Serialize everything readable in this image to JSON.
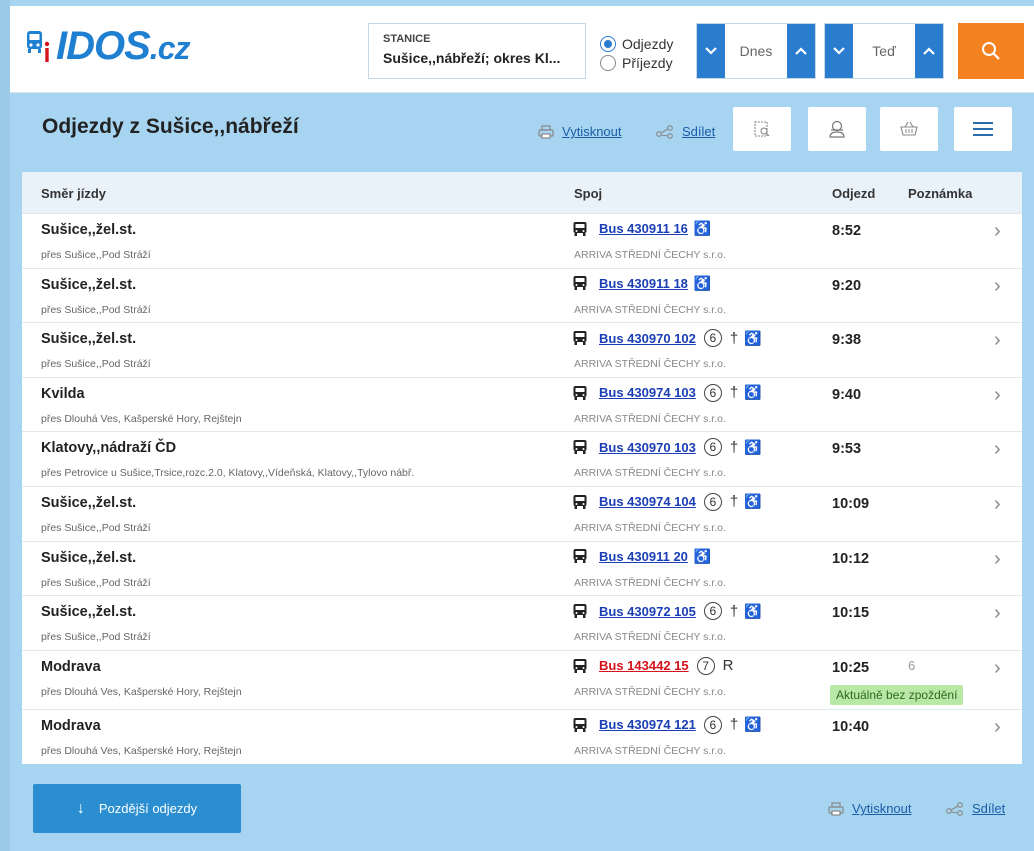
{
  "app": {
    "logo_main": "IDOS",
    "logo_suffix": ".cz",
    "brand_color": "#1f7fd1",
    "accent_color": "#f58220"
  },
  "search": {
    "station_label": "STANICE",
    "station_value": "Sušice,,nábřeží; okres Kl...",
    "mode_options": [
      "Odjezdy",
      "Příjezdy"
    ],
    "mode_selected": "Odjezdy",
    "date_value": "Dnes",
    "time_value": "Teď",
    "search_icon": "search-icon"
  },
  "header": {
    "title": "Odjezdy z Sušice,,nábřeží",
    "print_label": "Vytisknout",
    "share_label": "Sdílet"
  },
  "table": {
    "columns": [
      "Směr jízdy",
      "Spoj",
      "Odjezd",
      "Poznámka"
    ],
    "rows": [
      {
        "dest": "Sušice,,žel.st.",
        "via": "přes Sušice,,Pod Stráží",
        "bus": "Bus 430911 16",
        "marks": {
          "day": "",
          "cross": false,
          "R": false,
          "wheel": true
        },
        "carrier": "ARRIVA STŘEDNÍ ČECHY s.r.o.",
        "time": "8:52",
        "note": "",
        "status": "",
        "red": false
      },
      {
        "dest": "Sušice,,žel.st.",
        "via": "přes Sušice,,Pod Stráží",
        "bus": "Bus 430911 18",
        "marks": {
          "day": "",
          "cross": false,
          "R": false,
          "wheel": true
        },
        "carrier": "ARRIVA STŘEDNÍ ČECHY s.r.o.",
        "time": "9:20",
        "note": "",
        "status": "",
        "red": false
      },
      {
        "dest": "Sušice,,žel.st.",
        "via": "přes Sušice,,Pod Stráží",
        "bus": "Bus 430970 102",
        "marks": {
          "day": "6",
          "cross": true,
          "R": false,
          "wheel": true
        },
        "carrier": "ARRIVA STŘEDNÍ ČECHY s.r.o.",
        "time": "9:38",
        "note": "",
        "status": "",
        "red": false
      },
      {
        "dest": "Kvilda",
        "via": "přes Dlouhá Ves, Kašperské Hory, Rejštejn",
        "bus": "Bus 430974 103",
        "marks": {
          "day": "6",
          "cross": true,
          "R": false,
          "wheel": true
        },
        "carrier": "ARRIVA STŘEDNÍ ČECHY s.r.o.",
        "time": "9:40",
        "note": "",
        "status": "",
        "red": false
      },
      {
        "dest": "Klatovy,,nádraží ČD",
        "via": "přes Petrovice u Sušice,Trsice,rozc.2.0, Klatovy,,Vídeňská, Klatovy,,Tylovo nábř.",
        "bus": "Bus 430970 103",
        "marks": {
          "day": "6",
          "cross": true,
          "R": false,
          "wheel": true
        },
        "carrier": "ARRIVA STŘEDNÍ ČECHY s.r.o.",
        "time": "9:53",
        "note": "",
        "status": "",
        "red": false
      },
      {
        "dest": "Sušice,,žel.st.",
        "via": "přes Sušice,,Pod Stráží",
        "bus": "Bus 430974 104",
        "marks": {
          "day": "6",
          "cross": true,
          "R": false,
          "wheel": true
        },
        "carrier": "ARRIVA STŘEDNÍ ČECHY s.r.o.",
        "time": "10:09",
        "note": "",
        "status": "",
        "red": false
      },
      {
        "dest": "Sušice,,žel.st.",
        "via": "přes Sušice,,Pod Stráží",
        "bus": "Bus 430911 20",
        "marks": {
          "day": "",
          "cross": false,
          "R": false,
          "wheel": true
        },
        "carrier": "ARRIVA STŘEDNÍ ČECHY s.r.o.",
        "time": "10:12",
        "note": "",
        "status": "",
        "red": false
      },
      {
        "dest": "Sušice,,žel.st.",
        "via": "přes Sušice,,Pod Stráží",
        "bus": "Bus 430972 105",
        "marks": {
          "day": "6",
          "cross": true,
          "R": false,
          "wheel": true
        },
        "carrier": "ARRIVA STŘEDNÍ ČECHY s.r.o.",
        "time": "10:15",
        "note": "",
        "status": "",
        "red": false
      },
      {
        "dest": "Modrava",
        "via": "přes Dlouhá Ves, Kašperské Hory, Rejštejn",
        "bus": "Bus 143442 15",
        "marks": {
          "day": "7",
          "cross": false,
          "R": true,
          "wheel": false
        },
        "carrier": "ARRIVA STŘEDNÍ ČECHY s.r.o.",
        "time": "10:25",
        "note": "6",
        "status": "Aktuálně bez zpoždění",
        "red": true
      },
      {
        "dest": "Modrava",
        "via": "přes Dlouhá Ves, Kašperské Hory, Rejštejn",
        "bus": "Bus 430974 121",
        "marks": {
          "day": "6",
          "cross": true,
          "R": false,
          "wheel": true
        },
        "carrier": "ARRIVA STŘEDNÍ ČECHY s.r.o.",
        "time": "10:40",
        "note": "",
        "status": "",
        "red": false
      }
    ]
  },
  "footer": {
    "later_label": "Pozdější odjezdy",
    "print_label": "Vytisknout",
    "share_label": "Sdílet"
  }
}
